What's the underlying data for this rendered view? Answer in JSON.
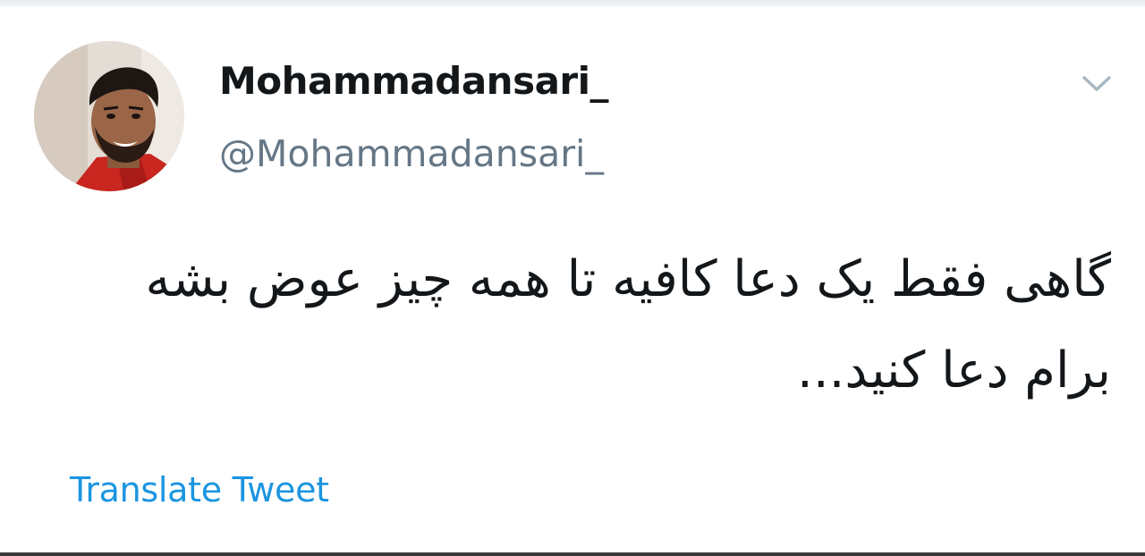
{
  "user": {
    "display_name": "Mohammadansari_",
    "handle": "@Mohammadansari_",
    "avatar": "profile-photo"
  },
  "tweet": {
    "line1": "گاهی فقط یک دعا کافیه تا همه چیز عوض بشه",
    "line2": "برام دعا کنید..."
  },
  "actions": {
    "translate_label": "Translate Tweet",
    "menu_icon": "chevron-down-icon"
  },
  "colors": {
    "name": "#14171a",
    "handle": "#657786",
    "link": "#1b95e0",
    "chevron": "#aab8c2"
  }
}
